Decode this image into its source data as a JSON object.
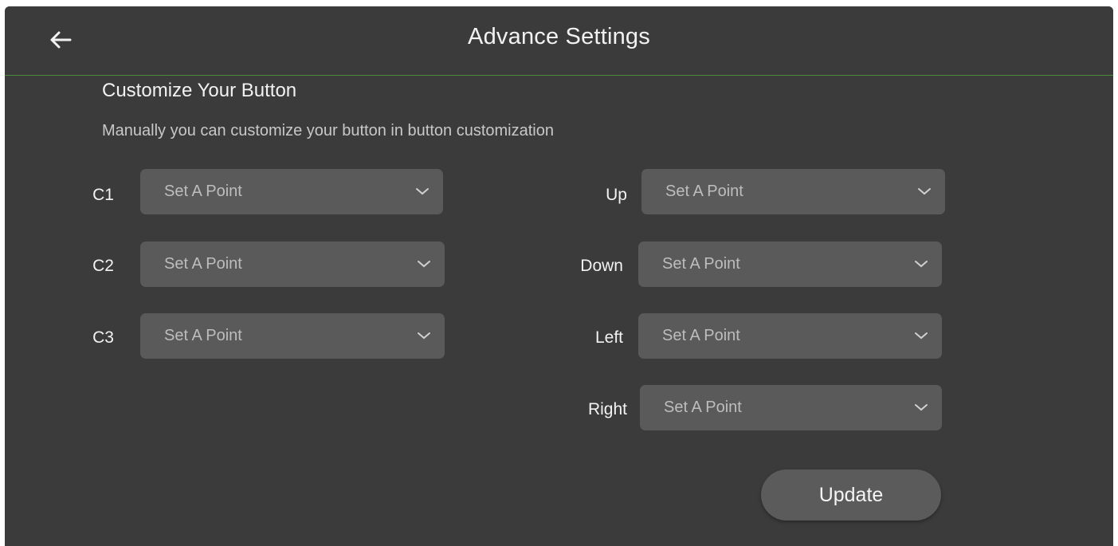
{
  "header": {
    "title": "Advance Settings",
    "back_icon": "arrow-left-icon"
  },
  "section": {
    "title": "Customize Your Button",
    "description": "Manually you can customize your button in button customization"
  },
  "left_fields": [
    {
      "label": "C1",
      "value": "Set A Point"
    },
    {
      "label": "C2",
      "value": "Set A Point"
    },
    {
      "label": "C3",
      "value": "Set A Point"
    }
  ],
  "right_fields": [
    {
      "label": "Up",
      "value": "Set A Point"
    },
    {
      "label": "Down",
      "value": "Set A Point"
    },
    {
      "label": "Left",
      "value": "Set A Point"
    },
    {
      "label": "Right",
      "value": "Set A Point"
    }
  ],
  "actions": {
    "update_label": "Update"
  },
  "colors": {
    "background": "#3b3b3b",
    "field": "#5a5a5a",
    "divider": "#4a8a3a"
  }
}
